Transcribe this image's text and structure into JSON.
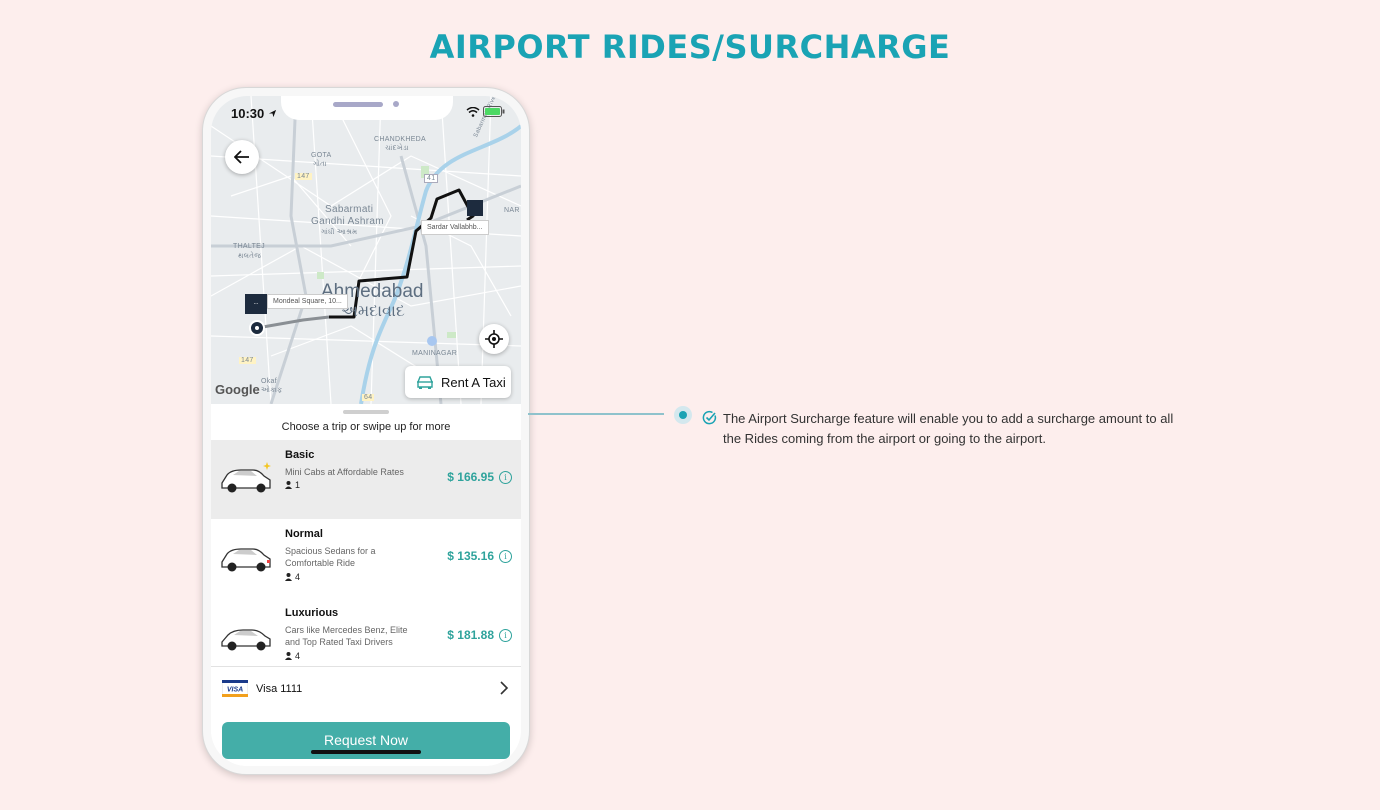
{
  "page_title": "AIRPORT RIDES/SURCHARGE",
  "status": {
    "time": "10:30"
  },
  "map": {
    "labels": [
      "CHANDKHEDA",
      "ચાંદખેડા",
      "GOTA",
      "ગોતા",
      "Sabarmati",
      "Gandhi Ashram",
      "ગાંધી આશ્રમ",
      "THALTEJ",
      "થલતેજ",
      "MANINAGAR",
      "NAR",
      "Okaf",
      "ઓકાફ",
      "Sabarmati River",
      "147",
      "41",
      "147",
      "64"
    ],
    "city_name": "Ahmedabad",
    "city_name_local": "અમદાવાદ",
    "pickup_label": "Mondeal Square, 10...",
    "drop_label": "Sardar Vallabhb...",
    "google": "Google"
  },
  "rent_taxi_label": "Rent A Taxi",
  "sheet": {
    "hint": "Choose a trip or swipe up for more",
    "rides": [
      {
        "name": "Basic",
        "desc": "Mini Cabs at Affordable Rates",
        "seats": "1",
        "price": "$ 166.95"
      },
      {
        "name": "Normal",
        "desc": "Spacious Sedans for a Comfortable Ride",
        "seats": "4",
        "price": "$ 135.16"
      },
      {
        "name": "Luxurious",
        "desc": "Cars like Mercedes Benz, Elite and Top Rated Taxi Drivers",
        "seats": "4",
        "price": "$ 181.88"
      }
    ],
    "payment": {
      "brand": "VISA",
      "label": "Visa 1111"
    },
    "request_label": "Request Now"
  },
  "feature_text": "The Airport Surcharge feature will enable you to add a surcharge amount to all the Rides coming from the airport or going to the airport.",
  "colors": {
    "accent": "#1aa3b4",
    "button": "#44aea8",
    "price": "#2fa39c",
    "background": "#fdeeed"
  }
}
